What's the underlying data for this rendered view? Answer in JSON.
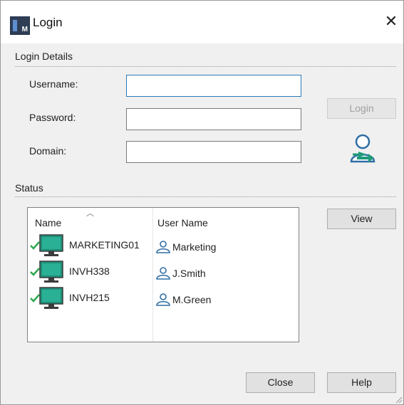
{
  "window": {
    "title": "Login",
    "app_icon_letter": "M"
  },
  "login_details": {
    "group_label": "Login Details",
    "username_label": "Username:",
    "password_label": "Password:",
    "domain_label": "Domain:",
    "username_value": "",
    "password_value": "",
    "domain_value": "",
    "login_button": "Login"
  },
  "status": {
    "group_label": "Status",
    "columns": {
      "name": "Name",
      "user_name": "User Name"
    },
    "rows": [
      {
        "name": "MARKETING01",
        "user": "Marketing"
      },
      {
        "name": "INVH338",
        "user": "J.Smith"
      },
      {
        "name": "INVH215",
        "user": "M.Green"
      }
    ],
    "view_button": "View"
  },
  "footer": {
    "close_button": "Close",
    "help_button": "Help"
  },
  "icons": {
    "close": "close-icon",
    "computer": "monitor-icon",
    "online": "checkmark-icon",
    "user": "user-icon",
    "login_user": "user-login-arrow-icon"
  },
  "colors": {
    "monitor": "#1f8f7a",
    "check": "#2fa84f",
    "user_icon": "#2e6da4",
    "focus_border": "#2a7ab8"
  }
}
